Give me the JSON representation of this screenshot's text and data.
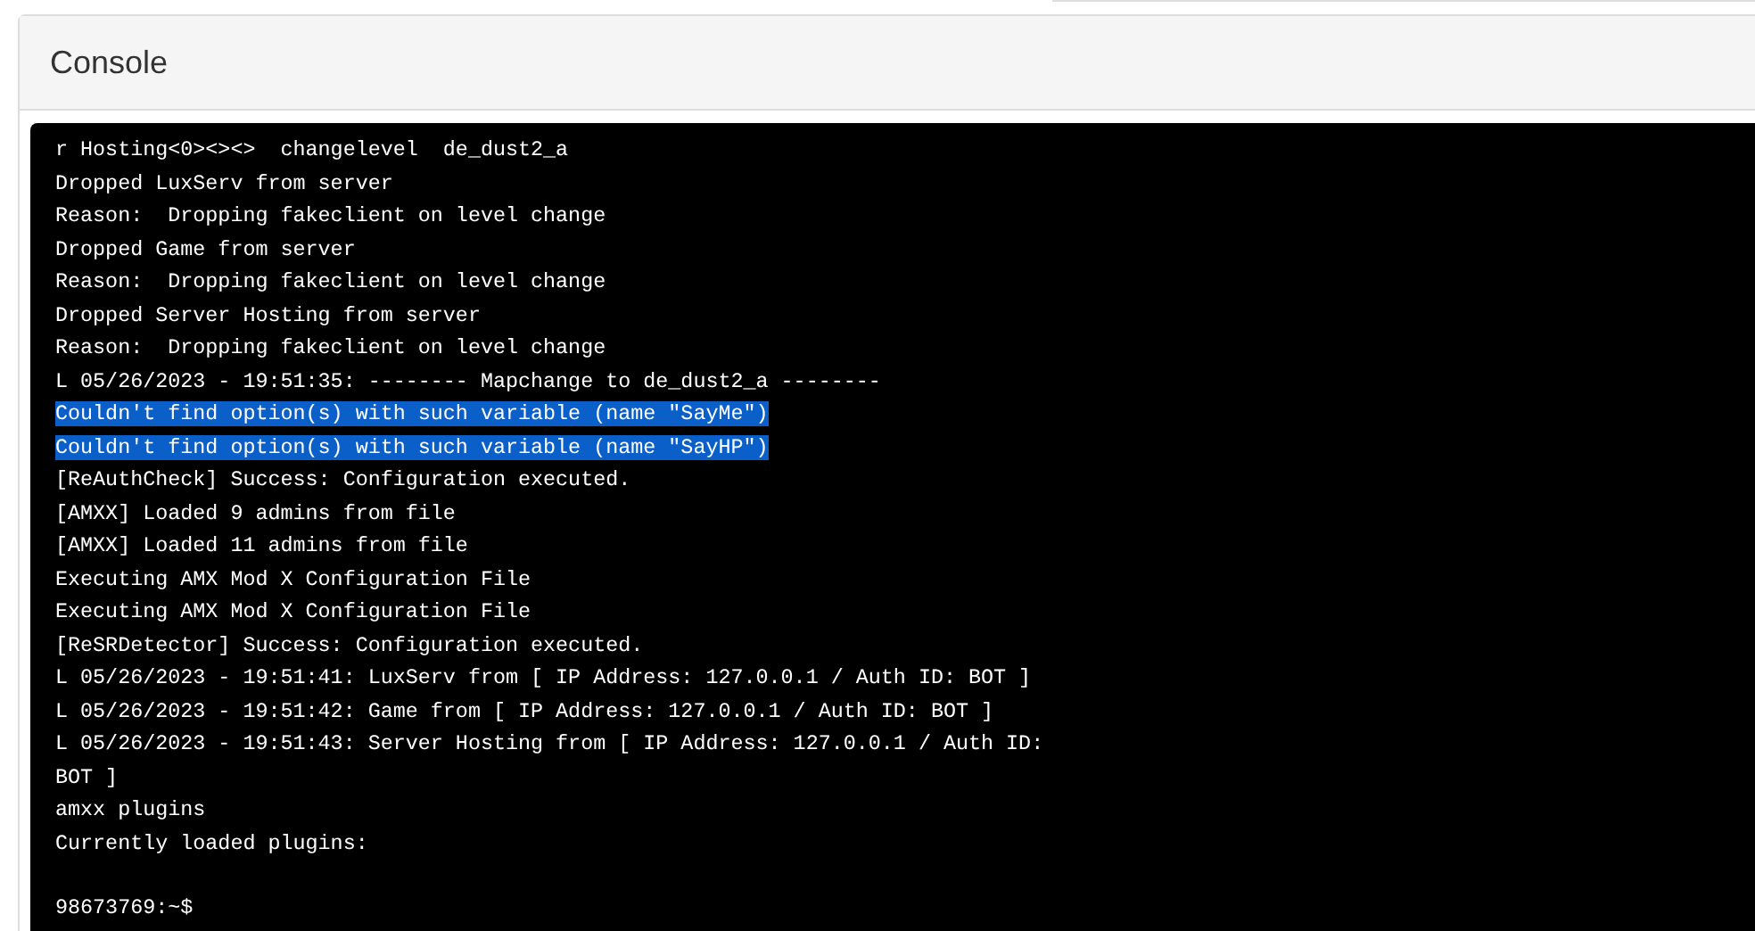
{
  "panel": {
    "title": "Console"
  },
  "console": {
    "lines": [
      {
        "text": "r Hosting<0><><>  changelevel  de_dust2_a",
        "selected": false
      },
      {
        "text": "Dropped LuxServ from server",
        "selected": false
      },
      {
        "text": "Reason:  Dropping fakeclient on level change",
        "selected": false
      },
      {
        "text": "Dropped Game from server",
        "selected": false
      },
      {
        "text": "Reason:  Dropping fakeclient on level change",
        "selected": false
      },
      {
        "text": "Dropped Server Hosting from server",
        "selected": false
      },
      {
        "text": "Reason:  Dropping fakeclient on level change",
        "selected": false
      },
      {
        "text": "L 05/26/2023 - 19:51:35: -------- Mapchange to de_dust2_a --------",
        "selected": false
      },
      {
        "text": "Couldn't find option(s) with such variable (name \"SayMe\")",
        "selected": true
      },
      {
        "text": "Couldn't find option(s) with such variable (name \"SayHP\")",
        "selected": true
      },
      {
        "text": "[ReAuthCheck] Success: Configuration executed.",
        "selected": false
      },
      {
        "text": "[AMXX] Loaded 9 admins from file",
        "selected": false
      },
      {
        "text": "[AMXX] Loaded 11 admins from file",
        "selected": false
      },
      {
        "text": "Executing AMX Mod X Configuration File",
        "selected": false
      },
      {
        "text": "Executing AMX Mod X Configuration File",
        "selected": false
      },
      {
        "text": "[ReSRDetector] Success: Configuration executed.",
        "selected": false
      },
      {
        "text": "L 05/26/2023 - 19:51:41: LuxServ from [ IP Address: 127.0.0.1 / Auth ID: BOT ]",
        "selected": false
      },
      {
        "text": "L 05/26/2023 - 19:51:42: Game from [ IP Address: 127.0.0.1 / Auth ID: BOT ]",
        "selected": false
      },
      {
        "text": "L 05/26/2023 - 19:51:43: Server Hosting from [ IP Address: 127.0.0.1 / Auth ID: BOT ]",
        "selected": false
      },
      {
        "text": "amxx plugins",
        "selected": false
      },
      {
        "text": "Currently loaded plugins:",
        "selected": false
      }
    ],
    "prompt": "98673769:~$"
  }
}
